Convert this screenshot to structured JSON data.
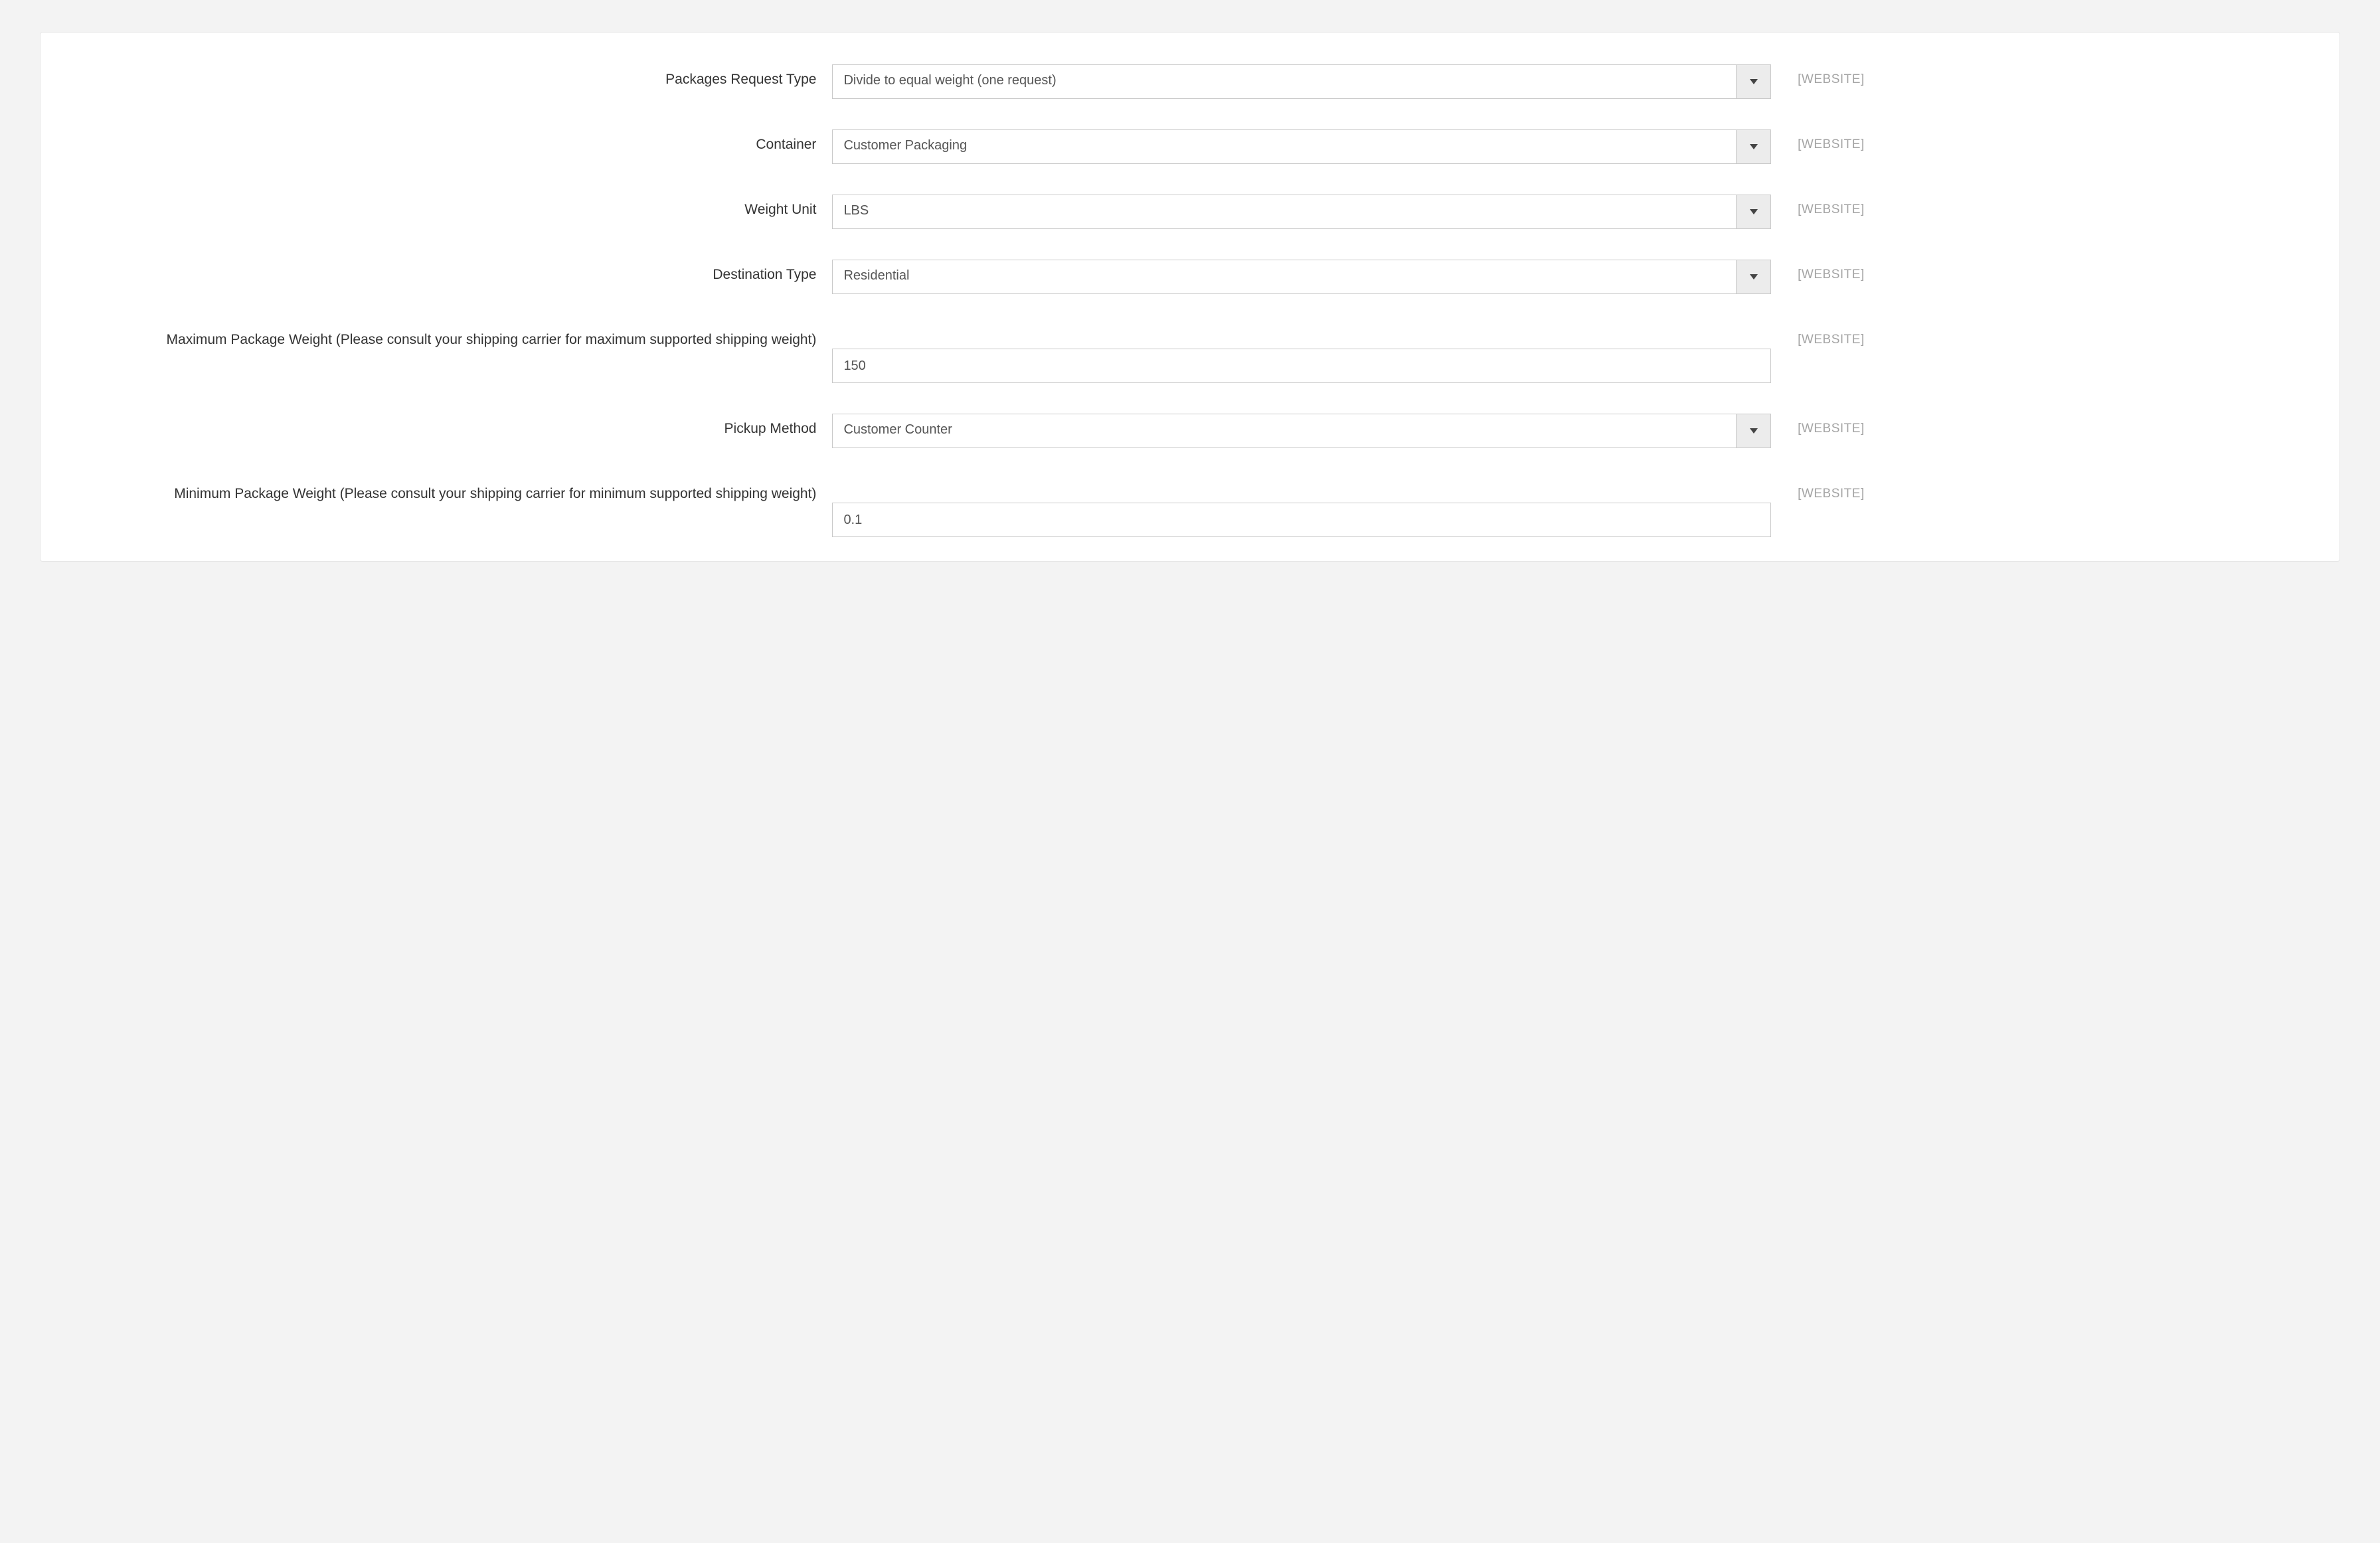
{
  "scope_tag": "[WEBSITE]",
  "fields": {
    "packages_request_type": {
      "label": "Packages Request Type",
      "value": "Divide to equal weight (one request)",
      "type": "select"
    },
    "container": {
      "label": "Container",
      "value": "Customer Packaging",
      "type": "select"
    },
    "weight_unit": {
      "label": "Weight Unit",
      "value": "LBS",
      "type": "select"
    },
    "destination_type": {
      "label": "Destination Type",
      "value": "Residential",
      "type": "select"
    },
    "max_package_weight": {
      "label": "Maximum Package Weight (Please consult your shipping carrier for maximum supported shipping weight)",
      "value": "150",
      "type": "text"
    },
    "pickup_method": {
      "label": "Pickup Method",
      "value": "Customer Counter",
      "type": "select"
    },
    "min_package_weight": {
      "label": "Minimum Package Weight (Please consult your shipping carrier for minimum supported shipping weight)",
      "value": "0.1",
      "type": "text"
    }
  }
}
